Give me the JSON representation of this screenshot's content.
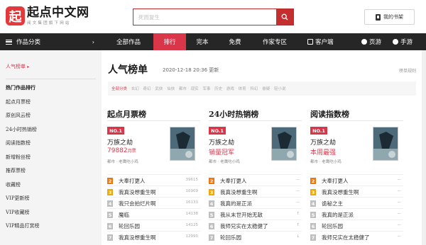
{
  "header": {
    "logo_mark": "起",
    "logo_name": "起点中文网",
    "logo_slogan": "阅文集团旗下网站",
    "search_placeholder": "死而复生",
    "bookshelf_label": "我的书架"
  },
  "nav": {
    "category_label": "作品分类",
    "items": [
      "全部作品",
      "排行",
      "完本",
      "免费",
      "作家专区"
    ],
    "client_label": "客户端",
    "webgame_label": "页游",
    "mobilegame_label": "手游"
  },
  "sidebar": {
    "current": "人气榜单",
    "section_heading": "热门作品排行",
    "items": [
      "起点月票榜",
      "原创风云榜",
      "24小时热销榜",
      "阅读指数榜",
      "新增粉丝榜",
      "推荐票榜",
      "收藏榜",
      "VIP更新榜",
      "VIP收藏榜",
      "VIP精品打赏榜"
    ]
  },
  "page": {
    "title": "人气榜单",
    "date": "2020-12-18 20:36 更新",
    "rule": "榜单规则",
    "filters": [
      "全部分类",
      "玄幻",
      "奇幻",
      "武侠",
      "仙侠",
      "都市",
      "现实",
      "军事",
      "历史",
      "游戏",
      "体育",
      "科幻",
      "悬疑",
      "轻小说"
    ]
  },
  "ranks": [
    {
      "title": "起点月票榜",
      "no1_label": "NO.1",
      "top_name": "万族之劫",
      "top_stat": "79882",
      "top_stat_unit": "月票",
      "top_meta": "都市 · 老鹰吃小鸡",
      "rows": [
        {
          "rank": "2",
          "title": "大奉打更人",
          "count": "39615"
        },
        {
          "rank": "3",
          "title": "我真没想重生啊",
          "count": "16909"
        },
        {
          "rank": "4",
          "title": "我只会拍烂片啊",
          "count": "16133"
        },
        {
          "rank": "5",
          "title": "魔临",
          "count": "14138"
        },
        {
          "rank": "6",
          "title": "轮回乐园",
          "count": "14125"
        },
        {
          "rank": "7",
          "title": "我真没想重生啊",
          "count": "12990"
        }
      ]
    },
    {
      "title": "24小时热销榜",
      "no1_label": "NO.1",
      "top_name": "万族之劫",
      "top_stat": "销量冠军",
      "top_stat_unit": "",
      "top_meta": "都市 · 老鹰吃小鸡",
      "rows": [
        {
          "rank": "2",
          "title": "大奉打更人",
          "count": "—"
        },
        {
          "rank": "3",
          "title": "我真没想重生啊",
          "count": "—"
        },
        {
          "rank": "4",
          "title": "我真的是正派",
          "count": "—"
        },
        {
          "rank": "5",
          "title": "我从末世开始无敌",
          "count": "↑"
        },
        {
          "rank": "6",
          "title": "我师兄实在太稳健了",
          "count": "↑"
        },
        {
          "rank": "7",
          "title": "轮回乐园",
          "count": "↓"
        }
      ]
    },
    {
      "title": "阅读指数榜",
      "no1_label": "NO.1",
      "top_name": "万族之劫",
      "top_stat": "本周最强",
      "top_stat_unit": "",
      "top_meta": "都市 · 老鹰吃小鸡",
      "rows": [
        {
          "rank": "2",
          "title": "大奉打更人",
          "count": "—"
        },
        {
          "rank": "3",
          "title": "我真没想重生啊",
          "count": "—"
        },
        {
          "rank": "4",
          "title": "诡秘之主",
          "count": "—"
        },
        {
          "rank": "5",
          "title": "我真的是正派",
          "count": "—"
        },
        {
          "rank": "6",
          "title": "轮回乐园",
          "count": "—"
        },
        {
          "rank": "7",
          "title": "我师兄实在太稳健了",
          "count": "—"
        }
      ]
    }
  ],
  "colors": {
    "brand_red": "#d9364a",
    "nav_bg": "#262626",
    "rank2": "#f0760f",
    "rank3": "#f2a800"
  }
}
